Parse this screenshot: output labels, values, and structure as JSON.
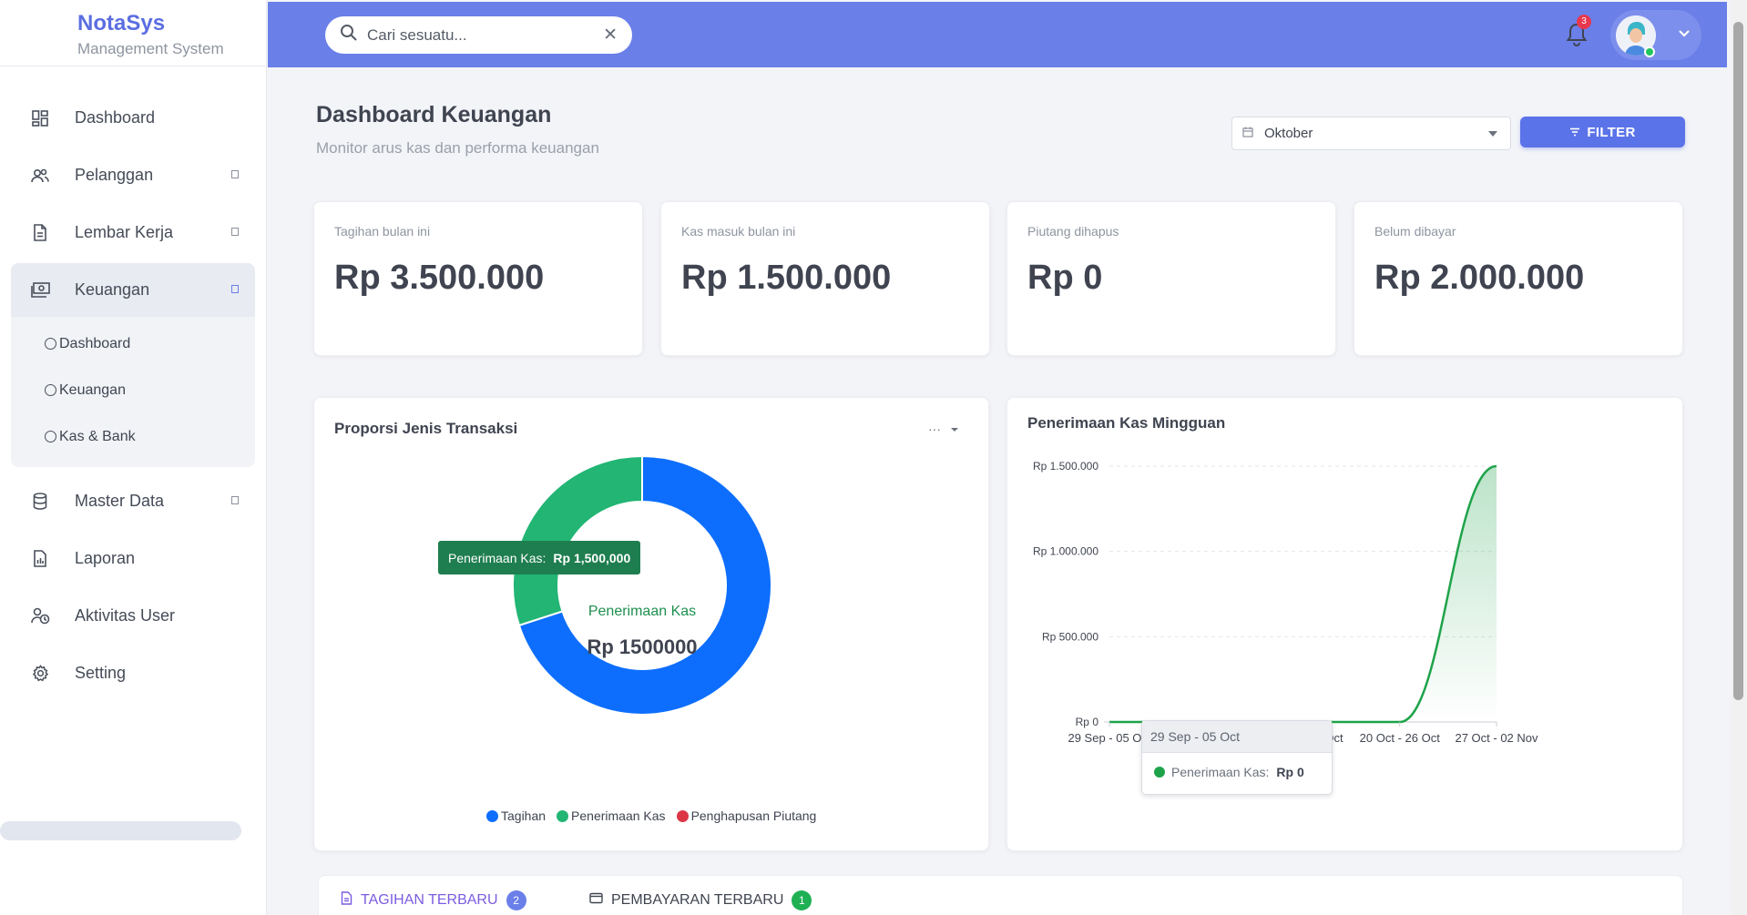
{
  "brand": {
    "name": "NotaSys",
    "subtitle": "Management System"
  },
  "sidebar": {
    "items": [
      {
        "label": "Dashboard",
        "icon": "dashboard-icon"
      },
      {
        "label": "Pelanggan",
        "icon": "users-icon",
        "has_children": true
      },
      {
        "label": "Lembar Kerja",
        "icon": "document-icon",
        "has_children": true
      },
      {
        "label": "Keuangan",
        "icon": "money-icon",
        "has_children": true,
        "active": true
      },
      {
        "label": "Master Data",
        "icon": "database-icon",
        "has_children": true
      },
      {
        "label": "Laporan",
        "icon": "report-icon"
      },
      {
        "label": "Aktivitas User",
        "icon": "user-activity-icon"
      },
      {
        "label": "Setting",
        "icon": "gear-icon"
      }
    ],
    "submenu": [
      {
        "label": "Dashboard"
      },
      {
        "label": "Keuangan"
      },
      {
        "label": "Kas & Bank"
      }
    ]
  },
  "topbar": {
    "search_value": "Cari sesuatu...",
    "notification_count": "3",
    "accent_color": "#6a7fe8"
  },
  "header": {
    "title": "Dashboard Keuangan",
    "subtitle": "Monitor arus kas dan performa keuangan",
    "month_value": "Oktober",
    "filter_label": "FILTER"
  },
  "stats": [
    {
      "label": "Tagihan bulan ini",
      "value": "Rp 3.500.000"
    },
    {
      "label": "Kas masuk bulan ini",
      "value": "Rp 1.500.000"
    },
    {
      "label": "Piutang dihapus",
      "value": "Rp 0"
    },
    {
      "label": "Belum dibayar",
      "value": "Rp 2.000.000"
    }
  ],
  "donut": {
    "title": "Proporsi Jenis Transaksi",
    "menu_label": "···",
    "center_label": "Penerimaan Kas",
    "center_value": "Rp 1500000",
    "tooltip_label": "Penerimaan Kas:",
    "tooltip_value": "Rp 1,500,000"
  },
  "line": {
    "title": "Penerimaan Kas Mingguan",
    "tooltip_header": "29 Sep - 05 Oct",
    "tooltip_label": "Penerimaan Kas:",
    "tooltip_value": "Rp 0"
  },
  "chart_data": [
    {
      "type": "pie",
      "title": "Proporsi Jenis Transaksi",
      "categories": [
        "Tagihan",
        "Penerimaan Kas",
        "Penghapusan Piutang"
      ],
      "values": [
        3500000,
        1500000,
        0
      ],
      "colors": [
        "#0d6efd",
        "#22b573",
        "#dc3545"
      ],
      "legend": "bottom"
    },
    {
      "type": "area",
      "title": "Penerimaan Kas Mingguan",
      "categories": [
        "29 Sep - 05 Oct",
        "06 Oct - 12 Oct",
        "13 Oct - 19 Oct",
        "20 Oct - 26 Oct",
        "27 Oct - 02 Nov"
      ],
      "series": [
        {
          "name": "Penerimaan Kas",
          "values": [
            0,
            0,
            0,
            0,
            1500000
          ],
          "color": "#1fa34a"
        }
      ],
      "y_ticks": [
        "Rp 0",
        "Rp 500.000",
        "Rp 1.000.000",
        "Rp 1.500.000"
      ],
      "ylim": [
        0,
        1500000
      ],
      "grid": true
    }
  ],
  "tabs": [
    {
      "label": "TAGIHAN TERBARU",
      "count": "2",
      "color": "#7c5ce0",
      "badge_color": "#6a7fe8"
    },
    {
      "label": "PEMBAYARAN TERBARU",
      "count": "1",
      "color": "#3f4450",
      "badge_color": "#1fb054"
    }
  ]
}
